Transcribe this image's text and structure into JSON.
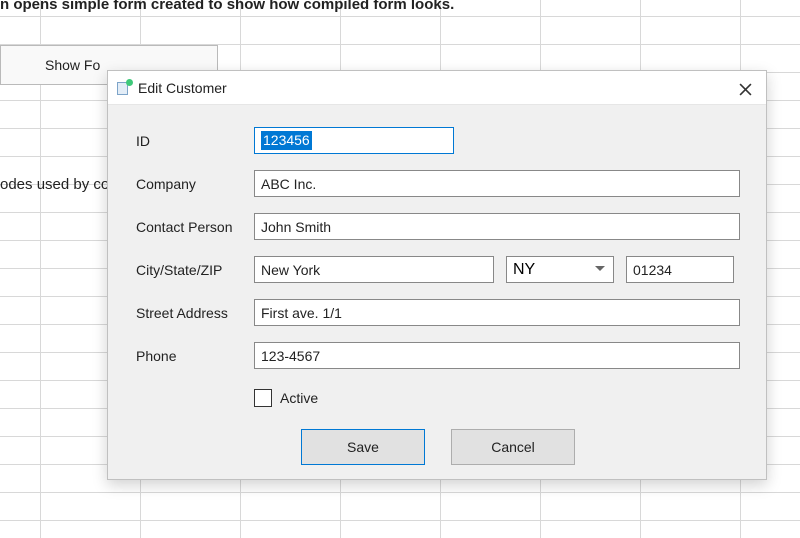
{
  "background": {
    "description_text": "n opens simple form created to show how compiled form looks.",
    "show_form_button": "Show Fo",
    "codes_text": "odes used by co"
  },
  "dialog": {
    "title": "Edit Customer",
    "labels": {
      "id": "ID",
      "company": "Company",
      "contact": "Contact Person",
      "csz": "City/State/ZIP",
      "street": "Street Address",
      "phone": "Phone",
      "active": "Active"
    },
    "values": {
      "id": "123456",
      "company": "ABC Inc.",
      "contact": "John Smith",
      "city": "New York",
      "state": "NY",
      "zip": "01234",
      "street": "First ave. 1/1",
      "phone": "123-4567",
      "active_checked": false
    },
    "buttons": {
      "save": "Save",
      "cancel": "Cancel"
    }
  }
}
